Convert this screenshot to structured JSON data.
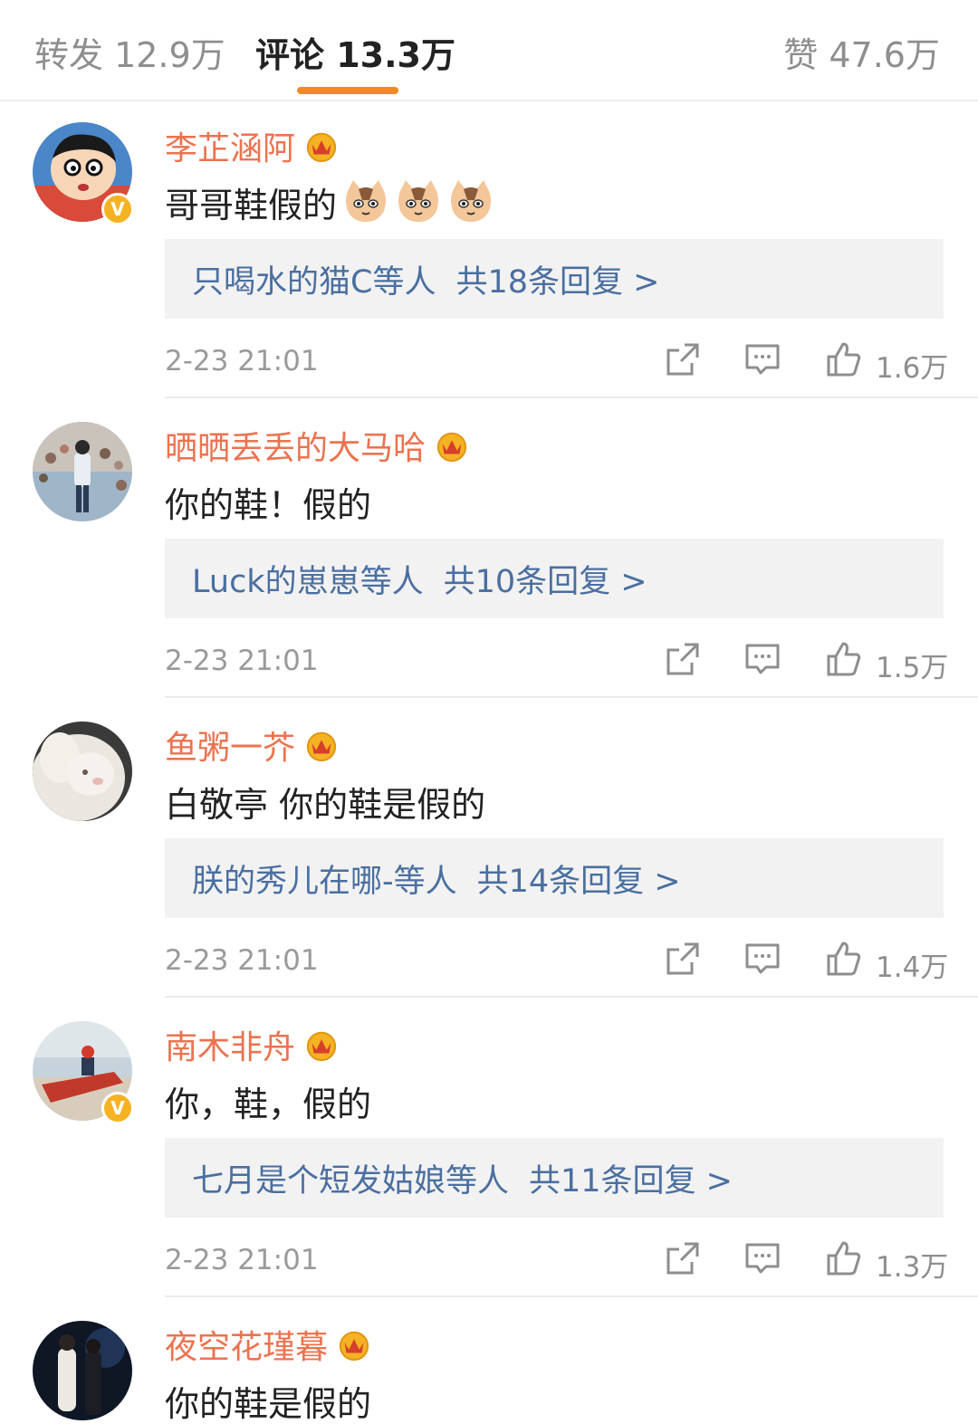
{
  "tabs": {
    "repost": "转发 12.9万",
    "comments": "评论 13.3万",
    "likes": "赞 47.6万"
  },
  "colors": {
    "accent": "#f08a24",
    "username": "#eb7350",
    "link": "#4a6fa0",
    "verified": "#f5b223"
  },
  "icons": {
    "share": "share-icon",
    "reply": "comment-icon",
    "like": "thumbs-up-icon",
    "vip": "vip-crown-icon",
    "verified": "verified-v-icon",
    "emoji": "cat-emoji-icon"
  },
  "comments": [
    {
      "username": "李芷涵阿",
      "text": "哥哥鞋假的",
      "verified_mark": "V",
      "replies_users": "只喝水的猫C等人",
      "replies_count": "共18条回复 >",
      "time": "2-23 21:01",
      "likes": "1.6万"
    },
    {
      "username": "晒晒丢丢的大马哈",
      "text": "你的鞋！假的",
      "replies_users": "Luck的崽崽等人",
      "replies_count": "共10条回复 >",
      "time": "2-23 21:01",
      "likes": "1.5万"
    },
    {
      "username": "鱼粥一芥",
      "text": "白敬亭 你的鞋是假的",
      "replies_users": "朕的秀儿在哪-等人",
      "replies_count": "共14条回复 >",
      "time": "2-23 21:01",
      "likes": "1.4万"
    },
    {
      "username": "南木非舟",
      "text": "你，鞋，假的",
      "verified_mark": "V",
      "replies_users": "七月是个短发姑娘等人",
      "replies_count": "共11条回复 >",
      "time": "2-23 21:01",
      "likes": "1.3万"
    },
    {
      "username": "夜空花瑾暮",
      "text": "你的鞋是假的"
    }
  ]
}
